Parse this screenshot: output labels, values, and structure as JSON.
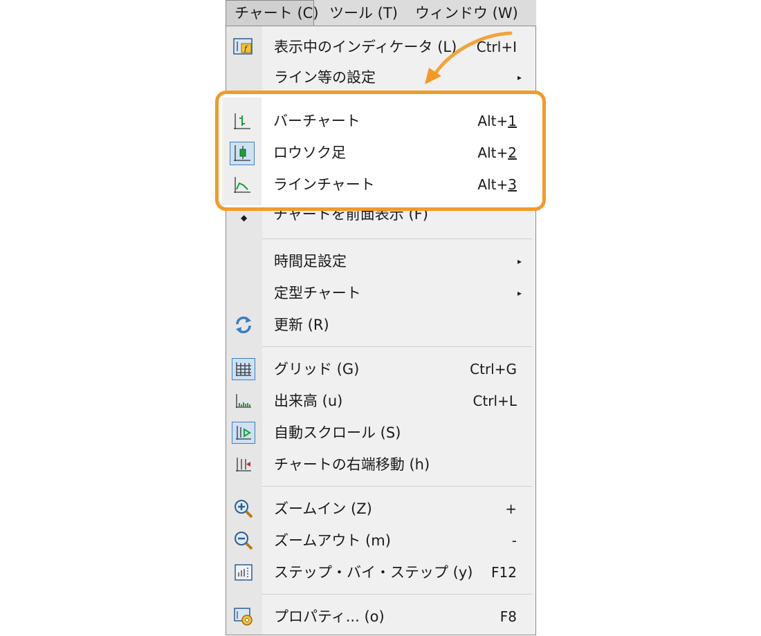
{
  "menubar": {
    "items": [
      {
        "label": "チャート (C)",
        "active": true
      },
      {
        "label": "ツール (T)",
        "active": false
      },
      {
        "label": "ウィンドウ (W)",
        "active": false
      }
    ]
  },
  "menu": {
    "top_items": [
      {
        "label": "表示中のインディケータ (L)",
        "shortcut": "Ctrl+I",
        "icon": "indicator-list-icon"
      },
      {
        "label": "ライン等の設定",
        "submenu": true
      }
    ],
    "chart_types": [
      {
        "label": "バーチャート",
        "shortcut_prefix": "Alt+",
        "shortcut_key": "1",
        "icon": "bar-chart-icon",
        "checked": false
      },
      {
        "label": "ロウソク足",
        "shortcut_prefix": "Alt+",
        "shortcut_key": "2",
        "icon": "candlestick-icon",
        "checked": true
      },
      {
        "label": "ラインチャート",
        "shortcut_prefix": "Alt+",
        "shortcut_key": "3",
        "icon": "line-chart-icon",
        "checked": false
      }
    ],
    "partial_item": {
      "label": "チャートを前面表示 (F)"
    },
    "group2": [
      {
        "label": "時間足設定",
        "submenu": true
      },
      {
        "label": "定型チャート",
        "submenu": true
      },
      {
        "label": "更新 (R)",
        "icon": "refresh-icon"
      }
    ],
    "group3": [
      {
        "label": "グリッド (G)",
        "shortcut": "Ctrl+G",
        "icon": "grid-icon",
        "checked": true
      },
      {
        "label": "出来高 (u)",
        "shortcut": "Ctrl+L",
        "icon": "volume-icon",
        "checked": false
      },
      {
        "label": "自動スクロール (S)",
        "shortcut": "",
        "icon": "auto-scroll-icon",
        "checked": true
      },
      {
        "label": "チャートの右端移動 (h)",
        "shortcut": "",
        "icon": "chart-shift-icon",
        "checked": false
      }
    ],
    "group4": [
      {
        "label": "ズームイン (Z)",
        "shortcut": "+",
        "icon": "zoom-in-icon"
      },
      {
        "label": "ズームアウト (m)",
        "shortcut": "-",
        "icon": "zoom-out-icon"
      },
      {
        "label": "ステップ・バイ・ステップ (y)",
        "shortcut": "F12",
        "icon": "step-by-step-icon"
      }
    ],
    "group5": [
      {
        "label": "プロパティ... (o)",
        "shortcut": "F8",
        "icon": "properties-icon"
      }
    ]
  },
  "colors": {
    "highlight": "#f39a25",
    "check_bg": "#cde1f3",
    "check_border": "#3c7fc4",
    "menu_bg": "#f0f0f0",
    "icon_col_bg": "#e6e6e6"
  }
}
